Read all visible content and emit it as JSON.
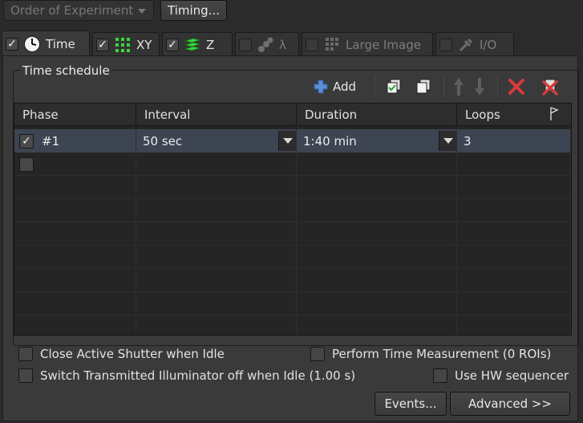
{
  "topbar": {
    "order_label": "Order of Experiment",
    "timing_label": "Timing..."
  },
  "tabs": [
    {
      "label": "Time",
      "checked": true,
      "icon": "clock-icon"
    },
    {
      "label": "XY",
      "checked": true,
      "icon": "grid-icon"
    },
    {
      "label": "Z",
      "checked": true,
      "icon": "stack-icon"
    },
    {
      "label": "λ",
      "checked": false,
      "icon": "lambda-dots-icon"
    },
    {
      "label": "Large Image",
      "checked": false,
      "icon": "large-image-icon"
    },
    {
      "label": "I/O",
      "checked": false,
      "icon": "io-icon"
    }
  ],
  "schedule": {
    "title": "Time schedule",
    "add_label": "Add",
    "columns": [
      "Phase",
      "Interval",
      "Duration",
      "Loops"
    ],
    "rows": [
      {
        "checked": true,
        "phase": "#1",
        "interval": "50 sec",
        "duration": "1:40 min",
        "loops": "3"
      },
      {
        "checked": false,
        "phase": "",
        "interval": "",
        "duration": "",
        "loops": ""
      }
    ]
  },
  "options": {
    "close_shutter": "Close Active Shutter when Idle",
    "perform_time": "Perform Time Measurement (0 ROIs)",
    "switch_illuminator": "Switch Transmitted Illuminator off when Idle (1.00 s)",
    "hw_sequencer": "Use HW sequencer"
  },
  "buttons": {
    "events": "Events...",
    "advanced": "Advanced >>"
  },
  "colors": {
    "selection": "#3d4452",
    "delete_red": "#d63a3a",
    "add_blue": "#5a8fd8"
  }
}
